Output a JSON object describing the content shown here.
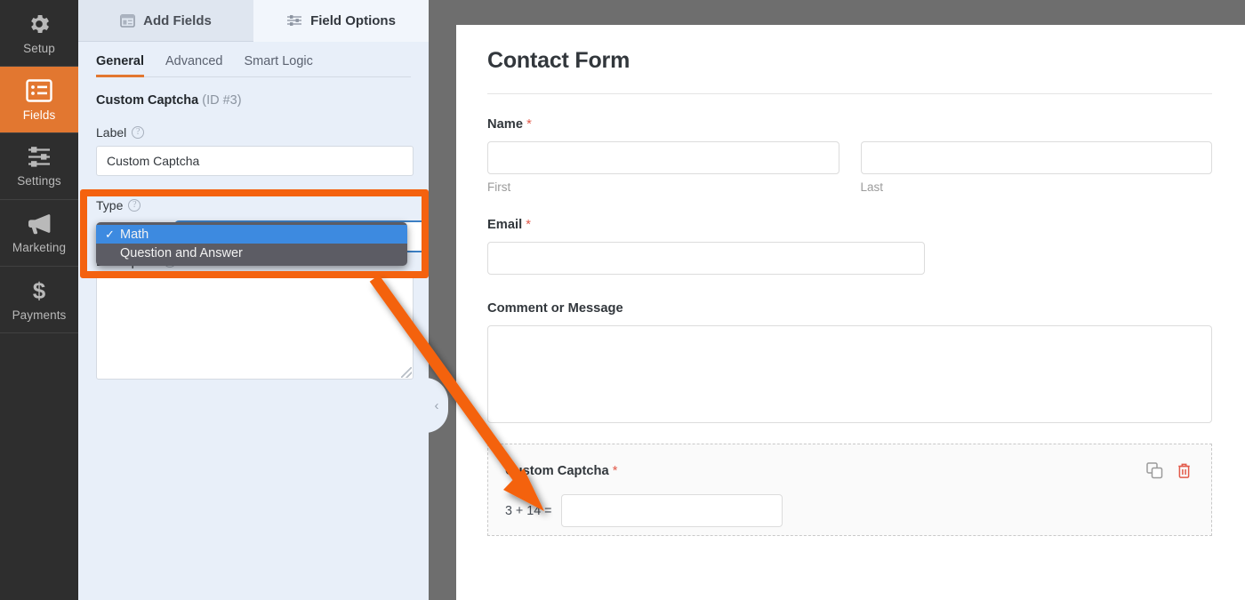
{
  "sidebar": {
    "items": [
      {
        "label": "Setup",
        "icon": "gear-icon",
        "active": false
      },
      {
        "label": "Fields",
        "icon": "list-icon",
        "active": true
      },
      {
        "label": "Settings",
        "icon": "sliders-icon",
        "active": false
      },
      {
        "label": "Marketing",
        "icon": "megaphone-icon",
        "active": false
      },
      {
        "label": "Payments",
        "icon": "dollar-icon",
        "active": false
      }
    ]
  },
  "panel": {
    "tabs": [
      {
        "label": "Add Fields",
        "icon": "panel-icon",
        "active": false
      },
      {
        "label": "Field Options",
        "icon": "sliders-icon",
        "active": true
      }
    ],
    "subtabs": [
      {
        "label": "General",
        "active": true
      },
      {
        "label": "Advanced",
        "active": false
      },
      {
        "label": "Smart Logic",
        "active": false
      }
    ],
    "field_name": "Custom Captcha",
    "field_id": "(ID #3)",
    "label_label": "Label",
    "label_value": "Custom Captcha",
    "type_label": "Type",
    "description_label": "Description",
    "description_value": "",
    "help_icon": "?"
  },
  "dropdown": {
    "open": true,
    "options": [
      {
        "label": "Math",
        "selected": true
      },
      {
        "label": "Question and Answer",
        "selected": false
      }
    ],
    "check_glyph": "✓",
    "highlight_color": "#3d8ae0",
    "menu_color": "#5c5c64"
  },
  "callout": {
    "color": "#f4620f"
  },
  "collapse": {
    "glyph": "‹"
  },
  "preview": {
    "title": "Contact Form",
    "required_mark": "*",
    "fields": [
      {
        "name": "name-field",
        "label": "Name",
        "required": true,
        "subfields": [
          {
            "sublabel": "First"
          },
          {
            "sublabel": "Last"
          }
        ]
      },
      {
        "name": "email-field",
        "label": "Email",
        "required": true,
        "subfields": []
      },
      {
        "name": "message-field",
        "label": "Comment or Message",
        "required": false,
        "subfields": []
      }
    ],
    "captcha": {
      "label": "Custom Captcha",
      "required": true,
      "question": "3 + 14 =",
      "answer_value": "",
      "actions": [
        {
          "name": "duplicate-icon",
          "color": "#9b9b9b"
        },
        {
          "name": "trash-icon",
          "color": "#e25a4a"
        }
      ]
    }
  },
  "colors": {
    "accent_orange": "#e27730",
    "callout_orange": "#f4620f",
    "sidebar_dark": "#2e2e2e",
    "panel_blue": "#e8eff9",
    "divider_gray": "#6e6e6e",
    "required_red": "#e25a4a"
  }
}
